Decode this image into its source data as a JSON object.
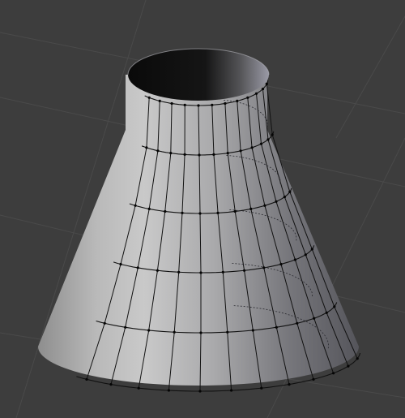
{
  "viewport": {
    "background": "#3d3d3d",
    "grid_color": "#4a4a4a",
    "wire_color": "#111111",
    "vertex_color": "#050505",
    "object_type": "truncated-cone-mesh",
    "view_mode": "edit-mode-solid-shading"
  }
}
